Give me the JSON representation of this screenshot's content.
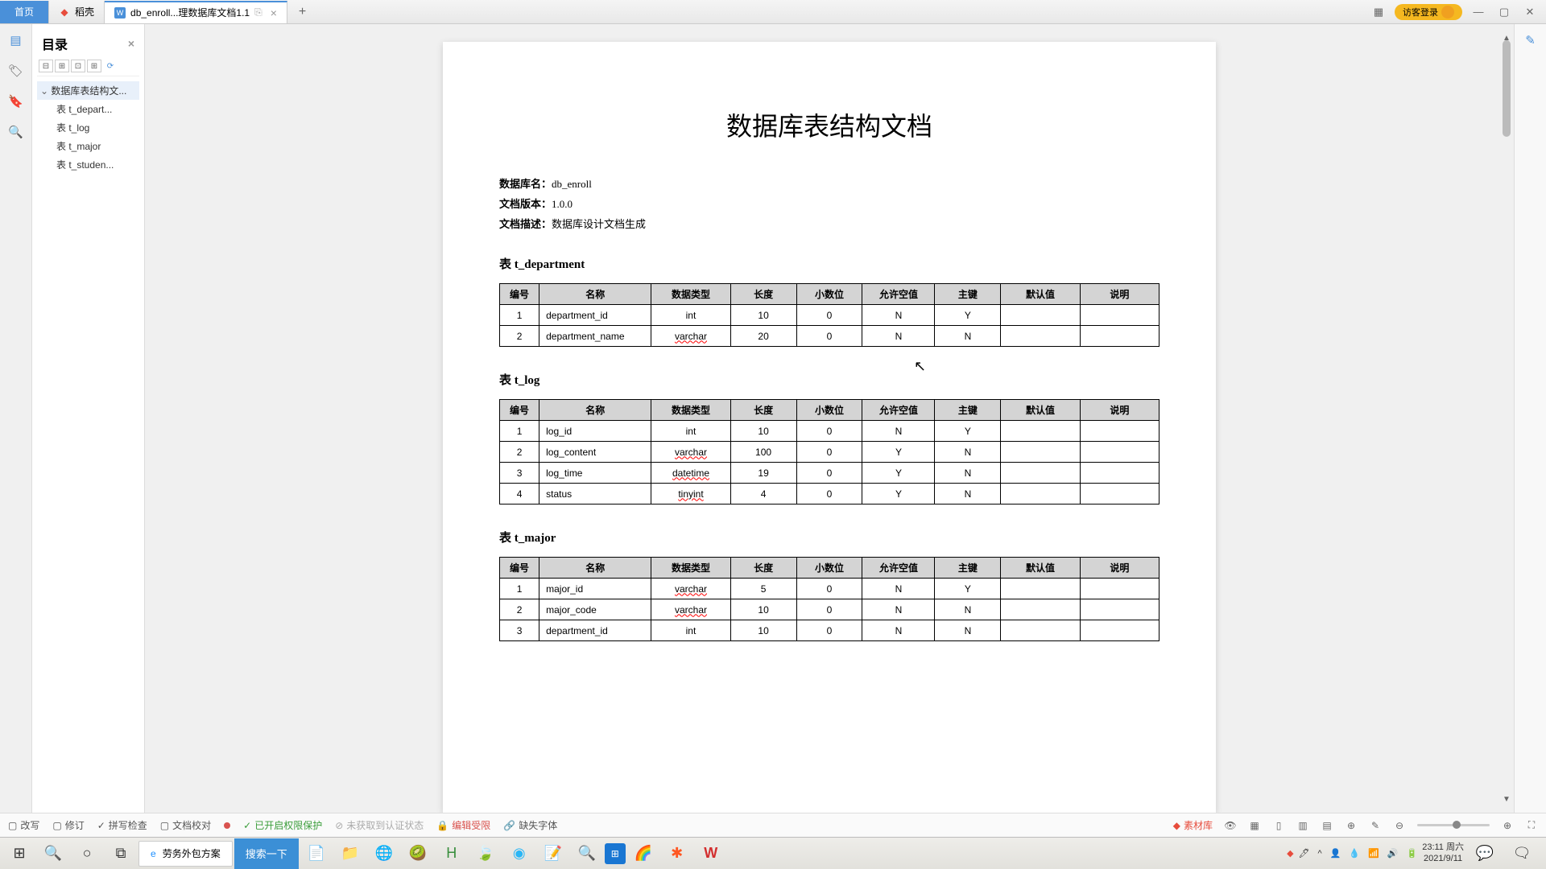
{
  "tabs": {
    "home": "首页",
    "tab1": "稻壳",
    "tab2": "db_enroll...理数据库文档1.1",
    "login": "访客登录"
  },
  "outline": {
    "title": "目录",
    "root": "数据库表结构文...",
    "items": [
      "表 t_depart...",
      "表 t_log",
      "表 t_major",
      "表 t_studen..."
    ]
  },
  "doc": {
    "title": "数据库表结构文档",
    "meta": [
      {
        "label": "数据库名：",
        "value": "db_enroll"
      },
      {
        "label": "文档版本：",
        "value": "1.0.0"
      },
      {
        "label": "文档描述：",
        "value": "数据库设计文档生成"
      }
    ],
    "headers": [
      "编号",
      "名称",
      "数据类型",
      "长度",
      "小数位",
      "允许空值",
      "主键",
      "默认值",
      "说明"
    ],
    "sections": [
      {
        "name": "表 t_department",
        "rows": [
          [
            "1",
            "department_id",
            "int",
            "10",
            "0",
            "N",
            "Y",
            "",
            ""
          ],
          [
            "2",
            "department_name",
            "varchar",
            "20",
            "0",
            "N",
            "N",
            "",
            ""
          ]
        ]
      },
      {
        "name": "表 t_log",
        "rows": [
          [
            "1",
            "log_id",
            "int",
            "10",
            "0",
            "N",
            "Y",
            "",
            ""
          ],
          [
            "2",
            "log_content",
            "varchar",
            "100",
            "0",
            "Y",
            "N",
            "",
            ""
          ],
          [
            "3",
            "log_time",
            "datetime",
            "19",
            "0",
            "Y",
            "N",
            "",
            ""
          ],
          [
            "4",
            "status",
            "tinyint",
            "4",
            "0",
            "Y",
            "N",
            "",
            ""
          ]
        ]
      },
      {
        "name": "表 t_major",
        "rows": [
          [
            "1",
            "major_id",
            "varchar",
            "5",
            "0",
            "N",
            "Y",
            "",
            ""
          ],
          [
            "2",
            "major_code",
            "varchar",
            "10",
            "0",
            "N",
            "N",
            "",
            ""
          ],
          [
            "3",
            "department_id",
            "int",
            "10",
            "0",
            "N",
            "N",
            "",
            ""
          ]
        ]
      }
    ]
  },
  "status": {
    "a": "改写",
    "b": "修订",
    "c": "拼写检查",
    "d": "文档校对",
    "e": "已开启权限保护",
    "f": "未获取到认证状态",
    "g": "编辑受限",
    "h": "缺失字体",
    "mat": "素材库"
  },
  "taskbar": {
    "app": "劳务外包方案",
    "search": "搜索一下"
  },
  "clock": {
    "time": "23:11",
    "day": "周六",
    "date": "2021/9/11"
  }
}
